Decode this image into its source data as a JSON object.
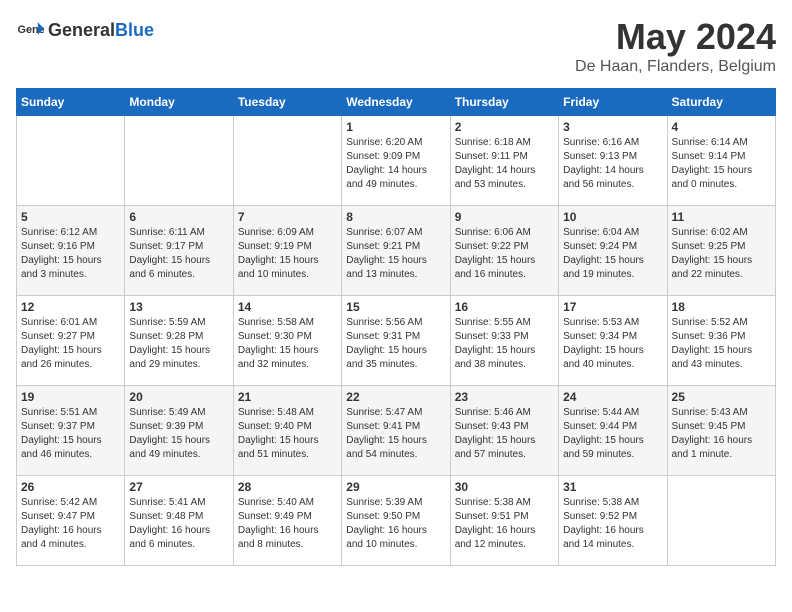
{
  "header": {
    "logo_general": "General",
    "logo_blue": "Blue",
    "title": "May 2024",
    "subtitle": "De Haan, Flanders, Belgium"
  },
  "weekdays": [
    "Sunday",
    "Monday",
    "Tuesday",
    "Wednesday",
    "Thursday",
    "Friday",
    "Saturday"
  ],
  "weeks": [
    [
      {
        "day": "",
        "info": ""
      },
      {
        "day": "",
        "info": ""
      },
      {
        "day": "",
        "info": ""
      },
      {
        "day": "1",
        "info": "Sunrise: 6:20 AM\nSunset: 9:09 PM\nDaylight: 14 hours\nand 49 minutes."
      },
      {
        "day": "2",
        "info": "Sunrise: 6:18 AM\nSunset: 9:11 PM\nDaylight: 14 hours\nand 53 minutes."
      },
      {
        "day": "3",
        "info": "Sunrise: 6:16 AM\nSunset: 9:13 PM\nDaylight: 14 hours\nand 56 minutes."
      },
      {
        "day": "4",
        "info": "Sunrise: 6:14 AM\nSunset: 9:14 PM\nDaylight: 15 hours\nand 0 minutes."
      }
    ],
    [
      {
        "day": "5",
        "info": "Sunrise: 6:12 AM\nSunset: 9:16 PM\nDaylight: 15 hours\nand 3 minutes."
      },
      {
        "day": "6",
        "info": "Sunrise: 6:11 AM\nSunset: 9:17 PM\nDaylight: 15 hours\nand 6 minutes."
      },
      {
        "day": "7",
        "info": "Sunrise: 6:09 AM\nSunset: 9:19 PM\nDaylight: 15 hours\nand 10 minutes."
      },
      {
        "day": "8",
        "info": "Sunrise: 6:07 AM\nSunset: 9:21 PM\nDaylight: 15 hours\nand 13 minutes."
      },
      {
        "day": "9",
        "info": "Sunrise: 6:06 AM\nSunset: 9:22 PM\nDaylight: 15 hours\nand 16 minutes."
      },
      {
        "day": "10",
        "info": "Sunrise: 6:04 AM\nSunset: 9:24 PM\nDaylight: 15 hours\nand 19 minutes."
      },
      {
        "day": "11",
        "info": "Sunrise: 6:02 AM\nSunset: 9:25 PM\nDaylight: 15 hours\nand 22 minutes."
      }
    ],
    [
      {
        "day": "12",
        "info": "Sunrise: 6:01 AM\nSunset: 9:27 PM\nDaylight: 15 hours\nand 26 minutes."
      },
      {
        "day": "13",
        "info": "Sunrise: 5:59 AM\nSunset: 9:28 PM\nDaylight: 15 hours\nand 29 minutes."
      },
      {
        "day": "14",
        "info": "Sunrise: 5:58 AM\nSunset: 9:30 PM\nDaylight: 15 hours\nand 32 minutes."
      },
      {
        "day": "15",
        "info": "Sunrise: 5:56 AM\nSunset: 9:31 PM\nDaylight: 15 hours\nand 35 minutes."
      },
      {
        "day": "16",
        "info": "Sunrise: 5:55 AM\nSunset: 9:33 PM\nDaylight: 15 hours\nand 38 minutes."
      },
      {
        "day": "17",
        "info": "Sunrise: 5:53 AM\nSunset: 9:34 PM\nDaylight: 15 hours\nand 40 minutes."
      },
      {
        "day": "18",
        "info": "Sunrise: 5:52 AM\nSunset: 9:36 PM\nDaylight: 15 hours\nand 43 minutes."
      }
    ],
    [
      {
        "day": "19",
        "info": "Sunrise: 5:51 AM\nSunset: 9:37 PM\nDaylight: 15 hours\nand 46 minutes."
      },
      {
        "day": "20",
        "info": "Sunrise: 5:49 AM\nSunset: 9:39 PM\nDaylight: 15 hours\nand 49 minutes."
      },
      {
        "day": "21",
        "info": "Sunrise: 5:48 AM\nSunset: 9:40 PM\nDaylight: 15 hours\nand 51 minutes."
      },
      {
        "day": "22",
        "info": "Sunrise: 5:47 AM\nSunset: 9:41 PM\nDaylight: 15 hours\nand 54 minutes."
      },
      {
        "day": "23",
        "info": "Sunrise: 5:46 AM\nSunset: 9:43 PM\nDaylight: 15 hours\nand 57 minutes."
      },
      {
        "day": "24",
        "info": "Sunrise: 5:44 AM\nSunset: 9:44 PM\nDaylight: 15 hours\nand 59 minutes."
      },
      {
        "day": "25",
        "info": "Sunrise: 5:43 AM\nSunset: 9:45 PM\nDaylight: 16 hours\nand 1 minute."
      }
    ],
    [
      {
        "day": "26",
        "info": "Sunrise: 5:42 AM\nSunset: 9:47 PM\nDaylight: 16 hours\nand 4 minutes."
      },
      {
        "day": "27",
        "info": "Sunrise: 5:41 AM\nSunset: 9:48 PM\nDaylight: 16 hours\nand 6 minutes."
      },
      {
        "day": "28",
        "info": "Sunrise: 5:40 AM\nSunset: 9:49 PM\nDaylight: 16 hours\nand 8 minutes."
      },
      {
        "day": "29",
        "info": "Sunrise: 5:39 AM\nSunset: 9:50 PM\nDaylight: 16 hours\nand 10 minutes."
      },
      {
        "day": "30",
        "info": "Sunrise: 5:38 AM\nSunset: 9:51 PM\nDaylight: 16 hours\nand 12 minutes."
      },
      {
        "day": "31",
        "info": "Sunrise: 5:38 AM\nSunset: 9:52 PM\nDaylight: 16 hours\nand 14 minutes."
      },
      {
        "day": "",
        "info": ""
      }
    ]
  ]
}
